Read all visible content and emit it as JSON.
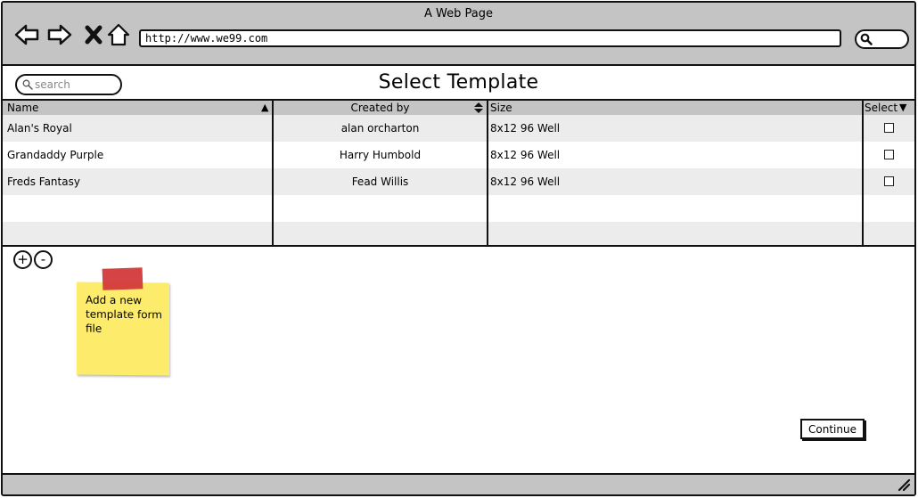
{
  "window": {
    "title": "A Web Page"
  },
  "browser": {
    "url": "http://www.we99.com",
    "icons": [
      "back-arrow-icon",
      "forward-arrow-icon",
      "close-icon",
      "home-icon",
      "search-icon"
    ]
  },
  "header": {
    "search_placeholder": "search",
    "title": "Select Template"
  },
  "table": {
    "columns": [
      {
        "label": "Name",
        "sort": "ascending"
      },
      {
        "label": "Created by",
        "sort": "both"
      },
      {
        "label": "Size",
        "sort": ""
      },
      {
        "label": "Select",
        "sort": "descending"
      }
    ],
    "rows": [
      {
        "name": "Alan's Royal",
        "created_by": "alan orcharton",
        "size": "8x12 96 Well",
        "selected": false
      },
      {
        "name": "Grandaddy Purple",
        "created_by": "Harry Humbold",
        "size": "8x12 96 Well",
        "selected": false
      },
      {
        "name": "Freds Fantasy",
        "created_by": "Fead Willis",
        "size": "8x12 96 Well",
        "selected": false
      }
    ]
  },
  "zoom": {
    "in_label": "+",
    "out_label": "-"
  },
  "note": {
    "text": "Add a new template form file",
    "color": "#fdeb6b",
    "tape_color": "#d33a3a"
  },
  "actions": {
    "continue_label": "Continue"
  }
}
